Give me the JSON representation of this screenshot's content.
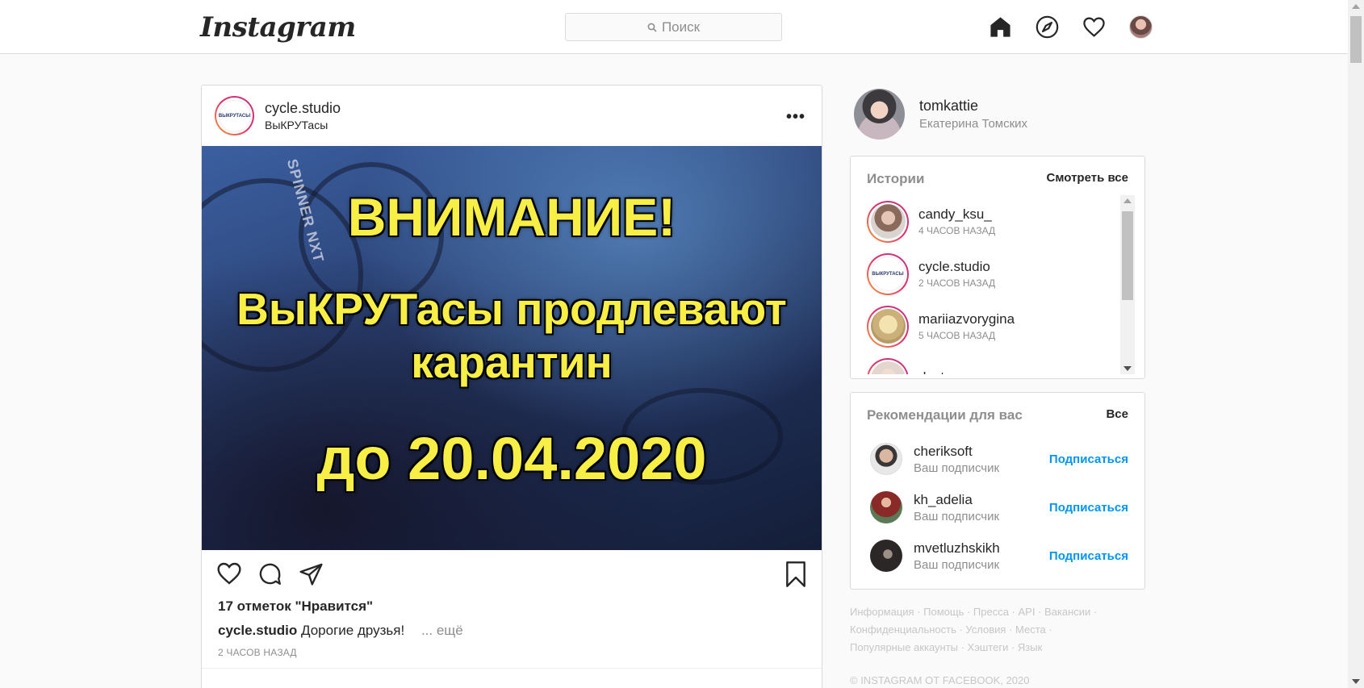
{
  "header": {
    "logo": "Instagram",
    "search_placeholder": "Поиск"
  },
  "post": {
    "username": "cycle.studio",
    "location": "ВыКРУТасы",
    "avatar_text": "ВЫКРУТАСЫ",
    "image": {
      "brand": "SPINNER NXT",
      "line1": "ВНИМАНИЕ!",
      "line2": "ВыКРУТасы продлевают",
      "line3": "карантин",
      "line4": "до 20.04.2020"
    },
    "likes": "17 отметок \"Нравится\"",
    "caption_user": "cycle.studio",
    "caption_text": "Дорогие друзья!",
    "caption_more": "... ещё",
    "time": "2 ЧАСОВ НАЗАД"
  },
  "profile": {
    "username": "tomkattie",
    "full_name": "Екатерина Томских"
  },
  "stories": {
    "title": "Истории",
    "see_all": "Смотреть все",
    "items": [
      {
        "name": "candy_ksu_",
        "time": "4 ЧАСОВ НАЗАД"
      },
      {
        "name": "cycle.studio",
        "time": "2 ЧАСОВ НАЗАД"
      },
      {
        "name": "mariiazvorygina",
        "time": "5 ЧАСОВ НАЗАД"
      },
      {
        "name": "doctor_annamama",
        "time": ""
      }
    ]
  },
  "recommendations": {
    "title": "Рекомендации для вас",
    "all": "Все",
    "follow_label": "Подписаться",
    "items": [
      {
        "name": "cheriksoft",
        "sub": "Ваш подписчик"
      },
      {
        "name": "kh_adelia",
        "sub": "Ваш подписчик"
      },
      {
        "name": "mvetluzhskikh",
        "sub": "Ваш подписчик"
      }
    ]
  },
  "footer": {
    "line1": "Информация · Помощь · Пресса · API · Вакансии ·",
    "line2": "Конфиденциальность · Условия · Места ·",
    "line3": "Популярные аккаунты · Хэштеги · Язык",
    "copyright": "© INSTAGRAM ОТ FACEBOOK, 2020"
  },
  "colors": {
    "accent": "#0095f6",
    "story_ring_start": "#f9a13a",
    "story_ring_end": "#c13584",
    "poster_text": "#f7ef45"
  }
}
